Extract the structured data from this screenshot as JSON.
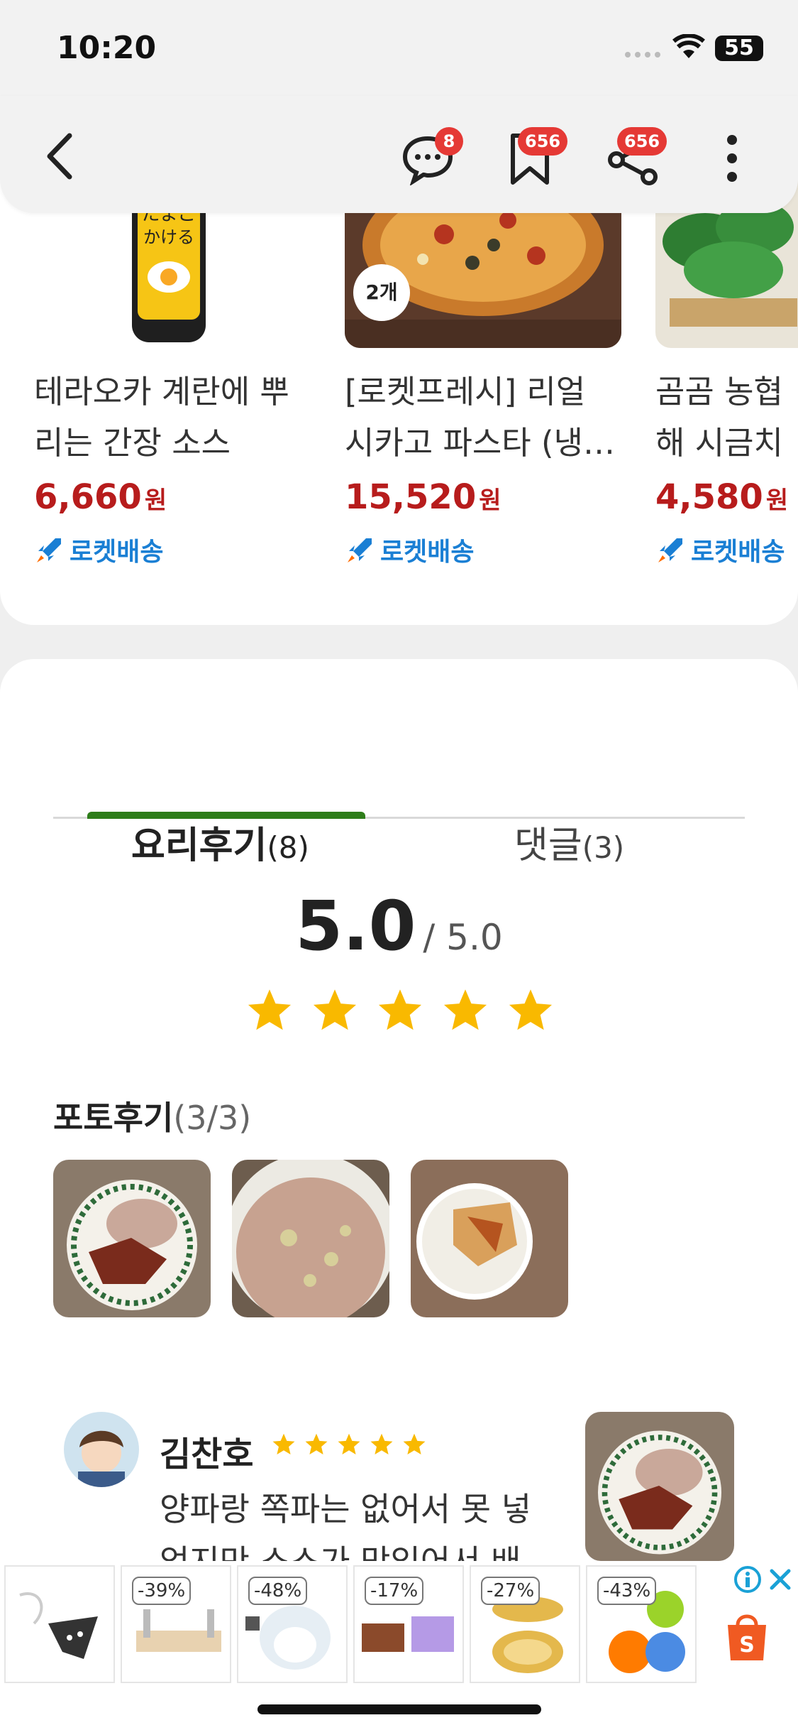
{
  "status": {
    "time": "10:20",
    "battery": "55"
  },
  "header": {
    "chat_badge": "8",
    "bookmark_badge": "656",
    "share_badge": "656"
  },
  "products": [
    {
      "name_line1": "테라오카 계란에 뿌",
      "name_line2": "리는 간장 소스",
      "price": "6,660",
      "unit": "원",
      "delivery": "로켓배송"
    },
    {
      "name_line1": "[로켓프레시] 리얼",
      "name_line2": "시카고 파스타 (냉…",
      "price": "15,520",
      "unit": "원",
      "delivery": "로켓배송",
      "count_badge": "2개"
    },
    {
      "name_line1": "곰곰 농협",
      "name_line2": "해 시금치",
      "price": "4,580",
      "unit": "원",
      "delivery": "로켓배송"
    }
  ],
  "tabs": {
    "review_label": "요리후기",
    "review_count": "(8)",
    "comment_label": "댓글",
    "comment_count": "(3)"
  },
  "rating": {
    "score": "5.0",
    "denominator": "/ 5.0",
    "stars": 5
  },
  "photo_reviews": {
    "title": "포토후기",
    "count": "(3/3)"
  },
  "review": {
    "author": "김찬호",
    "stars": 5,
    "text_line1": "양파랑 쪽파는 없어서 못 넣",
    "text_line2": "었지만 소스가 맛있어서 배"
  },
  "ad": {
    "discounts": [
      "-39%",
      "-48%",
      "-17%",
      "-27%",
      "-43%"
    ]
  },
  "colors": {
    "price": "#b71c1c",
    "rocket": "#1a7fd4",
    "star": "#f9b900",
    "tab_active": "#2e7d1a",
    "badge": "#e53935"
  }
}
